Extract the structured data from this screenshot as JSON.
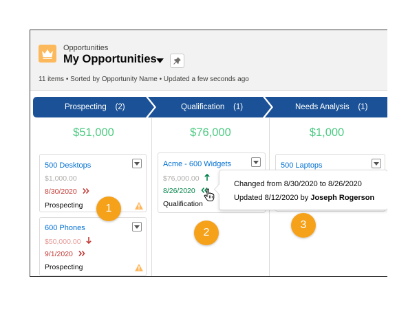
{
  "header": {
    "object_label": "Opportunities",
    "list_title": "My Opportunities",
    "meta": "11 items • Sorted by Opportunity Name • Updated a few seconds ago",
    "icons": {
      "app": "crown-icon",
      "caret": "caret-down-icon",
      "pin": "pin-icon"
    }
  },
  "colors": {
    "stage_bar": "#1b5297",
    "amount": "#4bca81",
    "link": "#0070d2",
    "overdue": "#c23934",
    "badge": "#f5a11a",
    "app_icon": "#fcb95b"
  },
  "stages": [
    {
      "name": "Prospecting",
      "count": "(2)",
      "amount": "$51,000"
    },
    {
      "name": "Qualification",
      "count": "(1)",
      "amount": "$76,000"
    },
    {
      "name": "Needs Analysis",
      "count": "(1)",
      "amount": "$1,000"
    }
  ],
  "cards": {
    "desktops": {
      "title": "500 Desktops",
      "amount": "$1,000.00",
      "date": "8/30/2020",
      "date_icon": "double-chevron-right-icon",
      "stage": "Prospecting",
      "warning_icon": "warning-icon"
    },
    "phones": {
      "title": "600 Phones",
      "amount": "$50,000.00",
      "amount_icon": "arrow-down-icon",
      "date": "9/1/2020",
      "date_icon": "double-chevron-right-icon",
      "stage": "Prospecting",
      "warning_icon": "warning-icon"
    },
    "widgets": {
      "title": "Acme - 600 Widgets",
      "amount": "$76,000.00",
      "amount_icon": "arrow-up-icon",
      "date": "8/26/2020",
      "date_icon": "double-chevron-left-icon",
      "stage": "Qualification"
    },
    "laptops": {
      "title": "500 Laptops"
    }
  },
  "tooltip": {
    "line1": "Changed from 8/30/2020 to 8/26/2020",
    "line2_prefix": "Updated 8/12/2020 by",
    "line2_user": "Joseph Rogerson"
  },
  "badges": [
    "1",
    "2",
    "3"
  ]
}
